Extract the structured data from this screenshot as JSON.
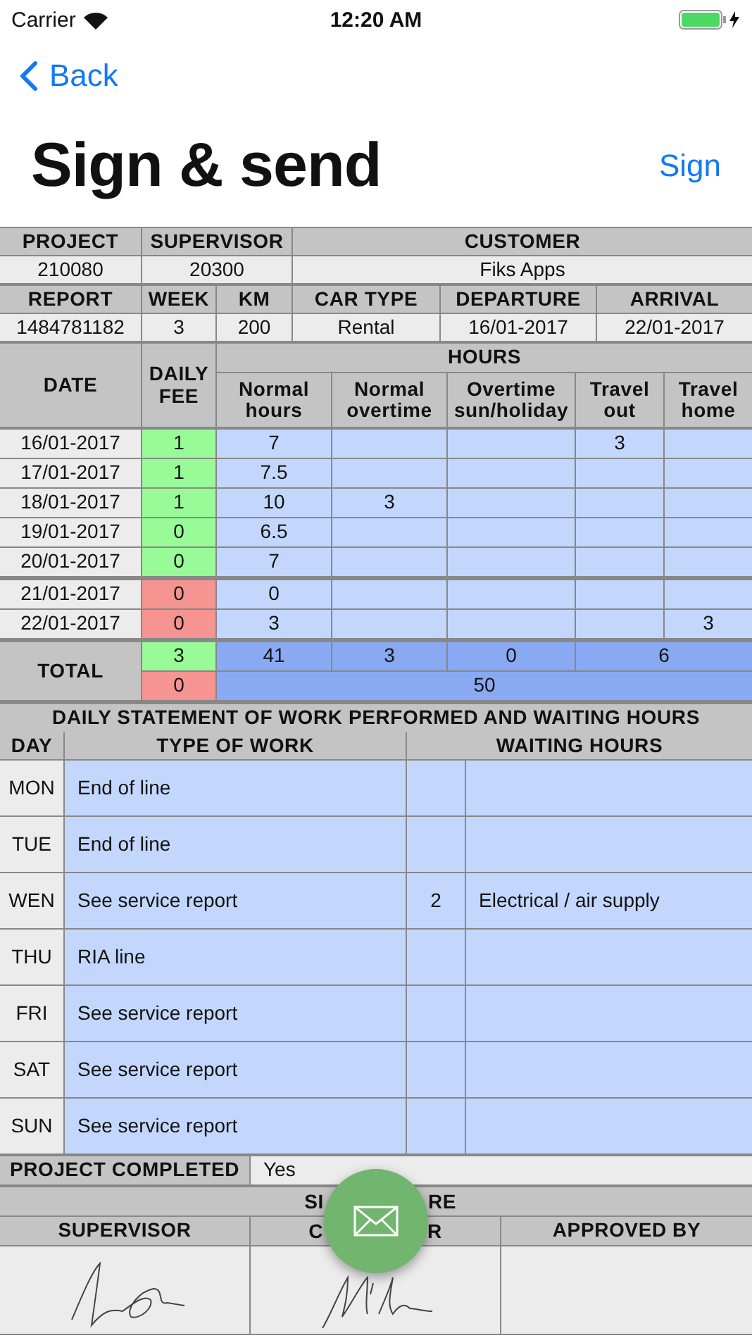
{
  "status_bar": {
    "carrier": "Carrier",
    "time": "12:20 AM"
  },
  "nav": {
    "back": "Back",
    "title": "Sign & send",
    "action": "Sign"
  },
  "info_blocks": [
    {
      "columns": [
        {
          "header": "PROJECT",
          "value": "210080"
        },
        {
          "header": "SUPERVISOR",
          "value": "20300"
        },
        {
          "header": "CUSTOMER",
          "value": "Fiks Apps"
        }
      ]
    },
    {
      "columns": [
        {
          "header": "REPORT",
          "value": "1484781182"
        },
        {
          "header": "WEEK",
          "value": "3"
        },
        {
          "header": "KM",
          "value": "200"
        },
        {
          "header": "CAR TYPE",
          "value": "Rental"
        },
        {
          "header": "DEPARTURE",
          "value": "16/01-2017"
        },
        {
          "header": "ARRIVAL",
          "value": "22/01-2017"
        }
      ]
    }
  ],
  "hours": {
    "date_header": "DATE",
    "fee_header": "DAILY FEE",
    "hours_header": "HOURS",
    "columns": [
      "Normal hours",
      "Normal overtime",
      "Overtime sun/holiday",
      "Travel out",
      "Travel home"
    ],
    "row_groups": [
      {
        "rows": [
          {
            "date": "16/01-2017",
            "fee": "1",
            "color": "#98fb98",
            "cells": [
              "7",
              null,
              null,
              "3",
              null
            ]
          },
          {
            "date": "17/01-2017",
            "fee": "1",
            "color": "#98fb98",
            "cells": [
              "7.5",
              null,
              null,
              null,
              null
            ]
          },
          {
            "date": "18/01-2017",
            "fee": "1",
            "color": "#98fb98",
            "cells": [
              "10",
              "3",
              null,
              null,
              null
            ]
          },
          {
            "date": "19/01-2017",
            "fee": "0",
            "color": "#98fb98",
            "cells": [
              "6.5",
              null,
              null,
              null,
              null
            ]
          },
          {
            "date": "20/01-2017",
            "fee": "0",
            "color": "#98fb98",
            "cells": [
              "7",
              null,
              null,
              null,
              null
            ]
          }
        ]
      },
      {
        "rows": [
          {
            "date": "21/01-2017",
            "fee": "0",
            "color": "#f59490",
            "cells": [
              "0",
              null,
              null,
              null,
              null
            ]
          },
          {
            "date": "22/01-2017",
            "fee": "0",
            "color": "#f59490",
            "cells": [
              "3",
              null,
              null,
              null,
              "3"
            ]
          }
        ]
      }
    ],
    "total": {
      "label": "TOTAL",
      "fees": [
        {
          "value": "3",
          "color": "#98fb98"
        },
        {
          "value": "0",
          "color": "#f59490"
        }
      ],
      "hours": [
        "41",
        "3",
        "0"
      ],
      "travel": "6",
      "sum": "50"
    }
  },
  "statement": {
    "title": "DAILY STATEMENT OF WORK PERFORMED AND WAITING HOURS",
    "day_header": "DAY",
    "work_header": "TYPE OF WORK",
    "waiting_header": "WAITING HOURS",
    "rows": [
      {
        "day": "MON",
        "work": "End of line",
        "waiting_hours": null,
        "waiting_reason": null
      },
      {
        "day": "TUE",
        "work": "End of line",
        "waiting_hours": null,
        "waiting_reason": null
      },
      {
        "day": "WEN",
        "work": "See service report",
        "waiting_hours": "2",
        "waiting_reason": "Electrical / air supply"
      },
      {
        "day": "THU",
        "work": "RIA line",
        "waiting_hours": null,
        "waiting_reason": null
      },
      {
        "day": "FRI",
        "work": "See service report",
        "waiting_hours": null,
        "waiting_reason": null
      },
      {
        "day": "SAT",
        "work": "See service report",
        "waiting_hours": null,
        "waiting_reason": null
      },
      {
        "day": "SUN",
        "work": "See service report",
        "waiting_hours": null,
        "waiting_reason": null
      }
    ]
  },
  "completed": {
    "label": "PROJECT COMPLETED",
    "value": "Yes"
  },
  "signature": {
    "title_parts": [
      "SI",
      "RE"
    ],
    "columns": [
      {
        "label_parts": [
          "SUPERVISOR"
        ],
        "signed": true
      },
      {
        "label_parts": [
          "C",
          "R"
        ],
        "signed": true
      },
      {
        "label_parts": [
          "APPROVED BY"
        ],
        "signed": false
      }
    ]
  }
}
